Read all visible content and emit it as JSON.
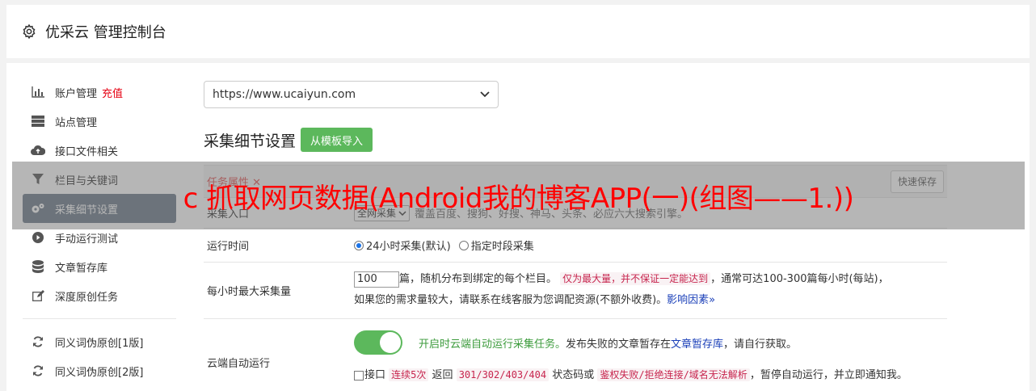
{
  "header": {
    "title": "优采云 管理控制台",
    "icon": "gear-icon"
  },
  "sidebar": {
    "items": [
      {
        "label": "账户管理",
        "badge": "充值",
        "icon": "bar-chart-icon"
      },
      {
        "label": "站点管理",
        "icon": "server-icon"
      },
      {
        "label": "接口文件相关",
        "icon": "cloud-upload-icon"
      },
      {
        "label": "栏目与关键词",
        "icon": "filter-icon"
      },
      {
        "label": "采集细节设置",
        "icon": "gears-icon",
        "active": true
      },
      {
        "label": "手动运行测试",
        "icon": "play-circle-icon"
      },
      {
        "label": "文章暂存库",
        "icon": "database-icon"
      },
      {
        "label": "深度原创任务",
        "icon": "edit-icon"
      }
    ],
    "items2": [
      {
        "label": "同义词伪原创[1版]",
        "icon": "refresh-icon"
      },
      {
        "label": "同义词伪原创[2版]",
        "icon": "refresh-icon"
      }
    ]
  },
  "main": {
    "site_select": "https://www.ucaiyun.com",
    "section_title": "采集细节设置",
    "import_button": "从模板导入",
    "task_props": "任务属性 ✕",
    "quick_save": "快速保存",
    "rows": {
      "entry": {
        "label": "采集入口",
        "select": "全网采集",
        "desc": "覆盖百度、搜狗、好搜、神马、头条、必应六大搜索引擎。"
      },
      "time": {
        "label": "运行时间",
        "opt1": "24小时采集(默认)",
        "opt2": "指定时段采集"
      },
      "max": {
        "label": "每小时最大采集量",
        "value": "100",
        "text1": "篇，随机分布到绑定的每个栏目。",
        "code1": "仅为最大量，并不保证一定能达到",
        "text2": "，通常可达100-300篇每小时(每站)，",
        "text3": "如果您的需求量较大，请联系在线客服为您调配资源(不额外收费)。",
        "link": "影响因素»"
      },
      "cloud": {
        "label": "云端自动运行",
        "green": "开启时云端自动运行采集任务。",
        "text1": "发布失败的文章暂存在",
        "link": "文章暂存库",
        "text2": "，请自行获取。",
        "chk_label": "接口",
        "code1": "连续5次",
        "text3": "返回",
        "code2": "301/302/403/404",
        "text4": "状态码或",
        "code3": "鉴权失败/拒绝连接/域名无法解析",
        "text5": "，暂停自动运行，并立即通知我。"
      }
    }
  },
  "overlay": {
    "text": "c 抓取网页数据(Android我的博客APP(一)(组图——1.))"
  },
  "colors": {
    "accent_green": "#5cb85c",
    "active_nav": "#6b7988",
    "red": "#e60012",
    "overlay_text": "#ff0000"
  }
}
